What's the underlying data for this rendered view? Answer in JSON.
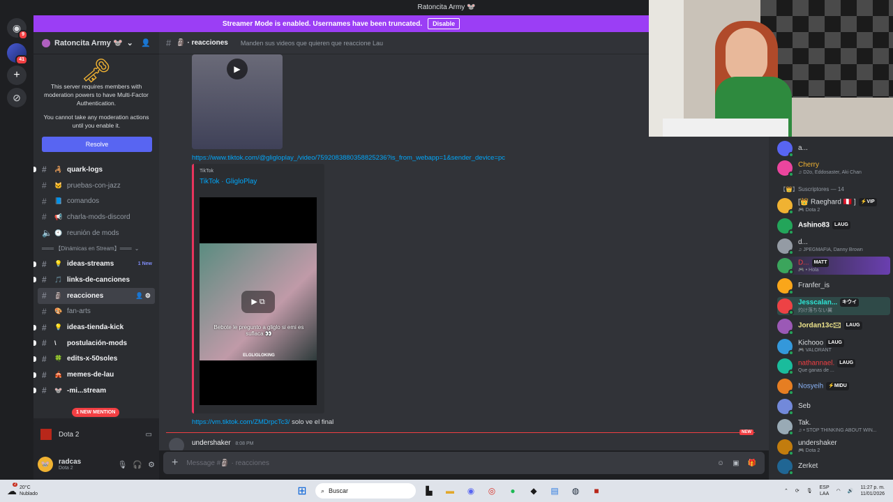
{
  "window": {
    "title": "Ratoncita Army 🐭"
  },
  "guilds": {
    "dm_badge": "9",
    "server_badge": "41"
  },
  "banner": {
    "text": "Streamer Mode is enabled. Usernames have been truncated.",
    "button": "Disable"
  },
  "server": {
    "name": "Ratoncita Army 🐭",
    "mfa_text1": "This server requires members with moderation powers to have Multi-Factor Authentication.",
    "mfa_text2": "You cannot take any moderation actions until you enable it.",
    "resolve": "Resolve"
  },
  "channels": [
    {
      "emoji": "🦂",
      "name": "quark-logs",
      "bold": true
    },
    {
      "emoji": "🐱",
      "name": "pruebas-con-jazz",
      "bold": false
    },
    {
      "emoji": "📘",
      "name": "comandos",
      "bold": false
    },
    {
      "emoji": "📢",
      "name": "charla-mods-discord",
      "bold": false
    },
    {
      "emoji": "🕙",
      "name": "reunión de mods",
      "bold": false,
      "voice": true
    }
  ],
  "category": "═══ 【Dinámicas en Stream】═══",
  "channels2": [
    {
      "emoji": "💡",
      "name": "ideas-streams",
      "bold": true,
      "badge": "1 New"
    },
    {
      "emoji": "🎵",
      "name": "links-de-canciones",
      "bold": true
    },
    {
      "emoji": "🗿",
      "name": "reacciones",
      "bold": true,
      "active": true
    },
    {
      "emoji": "🎨",
      "name": "fan-arts",
      "bold": false
    },
    {
      "emoji": "💡",
      "name": "ideas-tienda-kick",
      "bold": true
    },
    {
      "emoji": "\\",
      "name": "postulación-mods",
      "bold": true
    },
    {
      "emoji": "🍀",
      "name": "edits-x-50soles",
      "bold": true
    },
    {
      "emoji": "🎪",
      "name": "memes-de-lau",
      "bold": true
    },
    {
      "emoji": "🐭",
      "name": "-mi...stream",
      "bold": true
    }
  ],
  "mention_pill": "1 NEW MENTION",
  "voice": {
    "label": "Dota 2"
  },
  "user": {
    "name": "radcas",
    "status": "Dota 2"
  },
  "header": {
    "channel": "🗿 · reacciones",
    "topic": "Manden sus videos que quieren que reaccione Lau"
  },
  "messages": {
    "link1": "https://www.tiktok.com/@gligloplay_/video/7592083880358825236?is_from_webapp=1&sender_device=pc",
    "embed_provider": "TikTok",
    "embed_title": "TikTok · GligloPlay",
    "video_caption": "Bebote le pregunto a gliglo si emi es suflaca 👀",
    "video_watermark": "ELGLIGLOKING",
    "link2": "https://vm.tiktok.com/ZMDrpcTc3/",
    "link2_text": "solo ve el final",
    "new_label": "NEW",
    "next_author": "undershaker",
    "next_time": "8:08 PM"
  },
  "compose": {
    "placeholder": "Message #🗿 · reacciones"
  },
  "members": {
    "top": [
      {
        "name": "a...",
        "sub": ""
      },
      {
        "name": "Cherry",
        "sub": "♫ D2o, Eddosaster, Aki Chan"
      }
    ],
    "section": "【👑】Suscriptores — 14",
    "list": [
      {
        "name": "[👑 Raeghard 🇵🇪 ]",
        "tag": "⚡VIP",
        "sub": "🎮 Dota 2"
      },
      {
        "name": "Ashino83",
        "tag": "LAUG",
        "sub": ""
      },
      {
        "name": "d...",
        "tag": "",
        "sub": "♫ JPEGMAFIA, Danny Brown"
      },
      {
        "name": "D...",
        "tag": "MATT",
        "sub": "🎮 • Hola"
      },
      {
        "name": "Franfer_is",
        "tag": "",
        "sub": ""
      },
      {
        "name": "Jesscalan...",
        "tag": "キウイ",
        "sub": "灼け落ちない翼"
      },
      {
        "name": "Jordan13c🖂",
        "tag": "LAUG",
        "sub": ""
      },
      {
        "name": "Kichooo",
        "tag": "LAUG",
        "sub": "🎮 VALORANT"
      },
      {
        "name": "nathannael.",
        "tag": "LAUG",
        "sub": "Que ganas de ..."
      },
      {
        "name": "Nosyeih",
        "tag": "⚡MIDU",
        "sub": ""
      },
      {
        "name": "Seb",
        "tag": "",
        "sub": ""
      },
      {
        "name": "Tak.",
        "tag": "",
        "sub": "♫ • STOP THINKING ABOUT WIN..."
      },
      {
        "name": "undershaker",
        "tag": "",
        "sub": "🎮 Dota 2"
      },
      {
        "name": "Zerket",
        "tag": "",
        "sub": ""
      }
    ]
  },
  "taskbar": {
    "temp": "20°C",
    "weather": "Nublado",
    "weather_badge": "2",
    "search": "Buscar",
    "lang": "ESP",
    "lang2": "LAA",
    "time": "11:27 p. m.",
    "date": "11/01/2026"
  },
  "colors": {
    "accent": "#5865f2",
    "banner": "#9b3ef5",
    "mention": "#f23f43",
    "embed_bar": "#e8345c"
  }
}
